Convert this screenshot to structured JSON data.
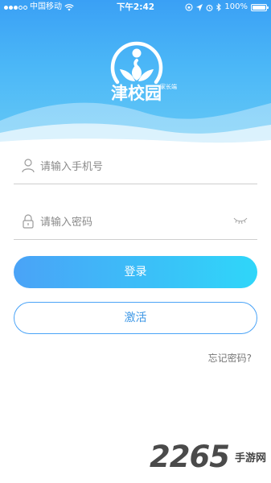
{
  "status_bar": {
    "carrier": "中国移动",
    "time": "下午2:42",
    "battery": "100%"
  },
  "brand": {
    "name": "津校园",
    "subtitle": "家长端"
  },
  "form": {
    "phone_placeholder": "请输入手机号",
    "phone_value": "",
    "password_placeholder": "请输入密码",
    "password_value": "",
    "login_label": "登录",
    "activate_label": "激活",
    "forgot_label": "忘记密码?"
  },
  "watermark": {
    "number": "2265",
    "text": "手游网"
  },
  "colors": {
    "accent": "#3aa0f5",
    "gradient_end": "#2fd6f9",
    "input_border": "#cfcfcf"
  },
  "icons": {
    "phone_field": "user-icon",
    "password_field": "lock-icon",
    "password_toggle": "eye-closed-icon",
    "wifi": "wifi-icon"
  }
}
